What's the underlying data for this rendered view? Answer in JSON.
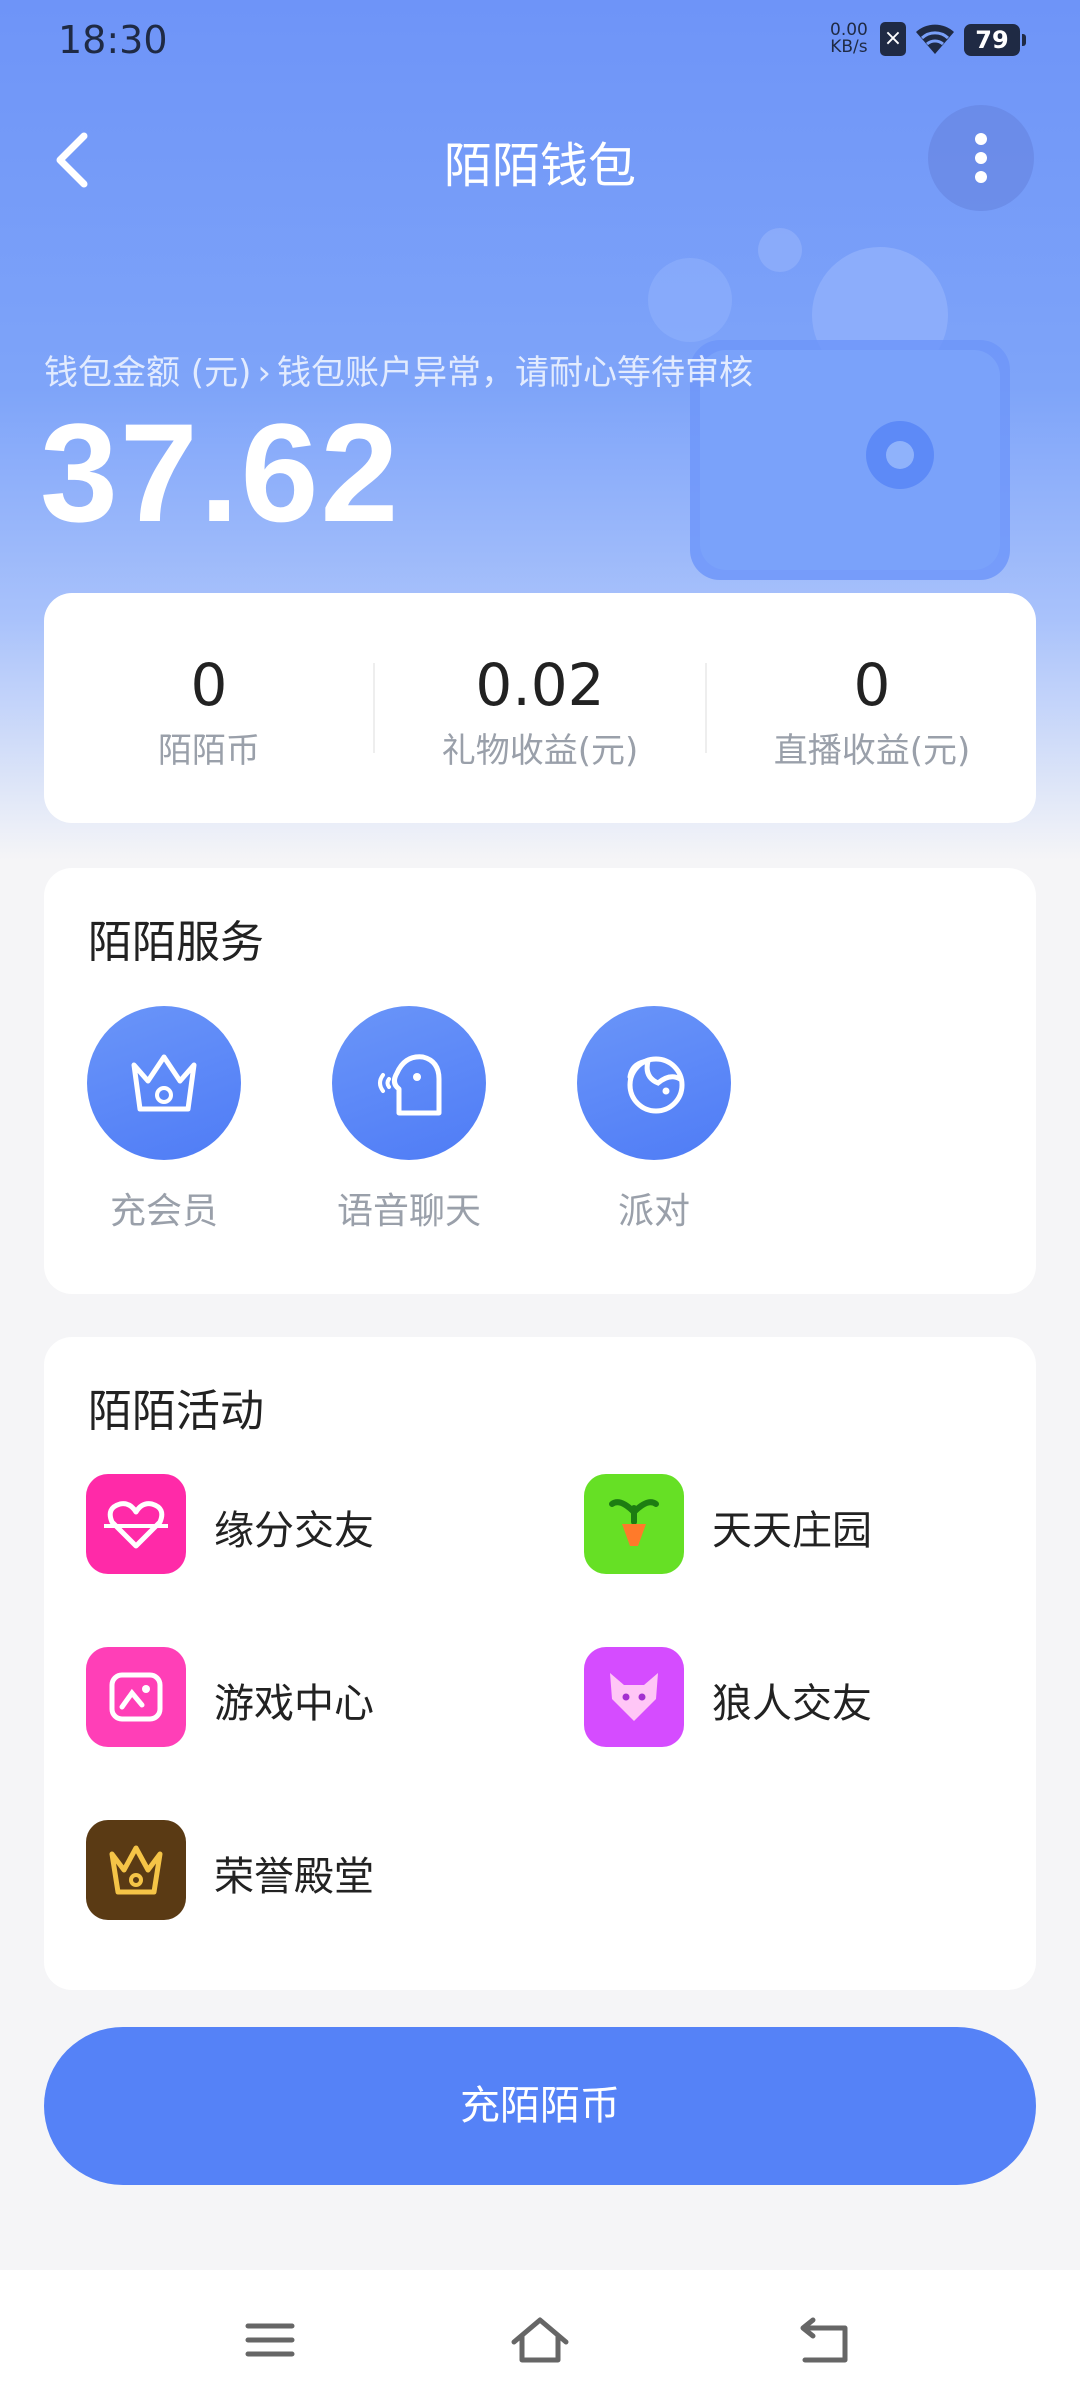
{
  "status_bar": {
    "time": "18:30",
    "net_speed_value": "0.00",
    "net_speed_unit": "KB/s",
    "battery": "79"
  },
  "header": {
    "title": "陌陌钱包",
    "back_icon": "back-chevron-icon",
    "more_icon": "more-vertical-icon"
  },
  "wallet": {
    "label": "钱包金额 (元)",
    "notice": "钱包账户异常，请耐心等待审核",
    "balance": "37.62"
  },
  "stats": [
    {
      "value": "0",
      "label": "陌陌币"
    },
    {
      "value": "0.02",
      "label": "礼物收益(元)"
    },
    {
      "value": "0",
      "label": "直播收益(元)"
    }
  ],
  "services": {
    "title": "陌陌服务",
    "items": [
      {
        "label": "充会员",
        "icon": "crown-icon"
      },
      {
        "label": "语音聊天",
        "icon": "voice-chat-icon"
      },
      {
        "label": "派对",
        "icon": "party-icon"
      }
    ]
  },
  "activities": {
    "title": "陌陌活动",
    "items": [
      {
        "label": "缘分交友",
        "icon": "heart-icon",
        "color": "#ff2aa8"
      },
      {
        "label": "天天庄园",
        "icon": "sprout-icon",
        "color": "#66e025"
      },
      {
        "label": "游戏中心",
        "icon": "game-icon",
        "color": "#ff3fb7"
      },
      {
        "label": "狼人交友",
        "icon": "wolf-icon",
        "color": "#d54cff"
      },
      {
        "label": "荣誉殿堂",
        "icon": "crown-icon",
        "color": "#5a3a14"
      }
    ]
  },
  "recharge_button": "充陌陌币",
  "colors": {
    "accent": "#5582f7",
    "hero": "#7ea4f9"
  }
}
